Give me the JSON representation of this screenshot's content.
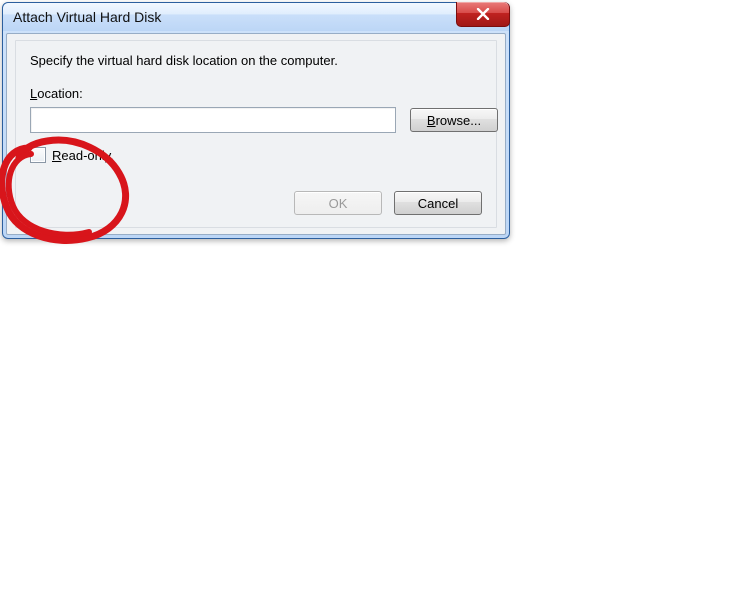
{
  "dialog": {
    "title": "Attach Virtual Hard Disk",
    "instruction": "Specify the virtual hard disk location on the computer.",
    "location_label": "Location:",
    "location_value": "",
    "browse_label": "Browse...",
    "readonly_label_prefix": "R",
    "readonly_label_rest": "ead-only.",
    "readonly_checked": false,
    "ok_label": "OK",
    "ok_enabled": false,
    "cancel_label": "Cancel"
  }
}
